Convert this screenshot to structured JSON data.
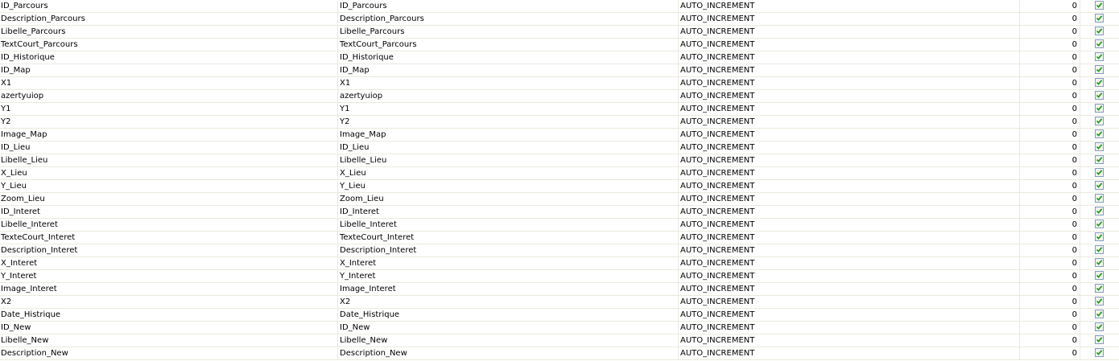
{
  "rows": [
    {
      "name": "ID_Parcours",
      "label": "ID_Parcours",
      "type": "AUTO_INCREMENT",
      "value": "0",
      "checked": true
    },
    {
      "name": "Description_Parcours",
      "label": "Description_Parcours",
      "type": "AUTO_INCREMENT",
      "value": "0",
      "checked": true
    },
    {
      "name": "Libelle_Parcours",
      "label": "Libelle_Parcours",
      "type": "AUTO_INCREMENT",
      "value": "0",
      "checked": true
    },
    {
      "name": "TextCourt_Parcours",
      "label": "TextCourt_Parcours",
      "type": "AUTO_INCREMENT",
      "value": "0",
      "checked": true
    },
    {
      "name": "ID_Historique",
      "label": "ID_Historique",
      "type": "AUTO_INCREMENT",
      "value": "0",
      "checked": true
    },
    {
      "name": "ID_Map",
      "label": "ID_Map",
      "type": "AUTO_INCREMENT",
      "value": "0",
      "checked": true
    },
    {
      "name": "X1",
      "label": "X1",
      "type": "AUTO_INCREMENT",
      "value": "0",
      "checked": true
    },
    {
      "name": "azertyuiop",
      "label": "azertyuiop",
      "type": "AUTO_INCREMENT",
      "value": "0",
      "checked": true
    },
    {
      "name": "Y1",
      "label": "Y1",
      "type": "AUTO_INCREMENT",
      "value": "0",
      "checked": true
    },
    {
      "name": "Y2",
      "label": "Y2",
      "type": "AUTO_INCREMENT",
      "value": "0",
      "checked": true
    },
    {
      "name": "Image_Map",
      "label": "Image_Map",
      "type": "AUTO_INCREMENT",
      "value": "0",
      "checked": true
    },
    {
      "name": "ID_Lieu",
      "label": "ID_Lieu",
      "type": "AUTO_INCREMENT",
      "value": "0",
      "checked": true
    },
    {
      "name": "Libelle_Lieu",
      "label": "Libelle_Lieu",
      "type": "AUTO_INCREMENT",
      "value": "0",
      "checked": true
    },
    {
      "name": "X_Lieu",
      "label": "X_Lieu",
      "type": "AUTO_INCREMENT",
      "value": "0",
      "checked": true
    },
    {
      "name": "Y_Lieu",
      "label": "Y_Lieu",
      "type": "AUTO_INCREMENT",
      "value": "0",
      "checked": true
    },
    {
      "name": "Zoom_Lieu",
      "label": "Zoom_Lieu",
      "type": "AUTO_INCREMENT",
      "value": "0",
      "checked": true
    },
    {
      "name": "ID_Interet",
      "label": "ID_Interet",
      "type": "AUTO_INCREMENT",
      "value": "0",
      "checked": true
    },
    {
      "name": "Libelle_Interet",
      "label": "Libelle_Interet",
      "type": "AUTO_INCREMENT",
      "value": "0",
      "checked": true
    },
    {
      "name": "TexteCourt_Interet",
      "label": "TexteCourt_Interet",
      "type": "AUTO_INCREMENT",
      "value": "0",
      "checked": true
    },
    {
      "name": "Description_Interet",
      "label": "Description_Interet",
      "type": "AUTO_INCREMENT",
      "value": "0",
      "checked": true
    },
    {
      "name": "X_Interet",
      "label": "X_Interet",
      "type": "AUTO_INCREMENT",
      "value": "0",
      "checked": true
    },
    {
      "name": "Y_Interet",
      "label": "Y_Interet",
      "type": "AUTO_INCREMENT",
      "value": "0",
      "checked": true
    },
    {
      "name": "Image_Interet",
      "label": "Image_Interet",
      "type": "AUTO_INCREMENT",
      "value": "0",
      "checked": true
    },
    {
      "name": "X2",
      "label": "X2",
      "type": "AUTO_INCREMENT",
      "value": "0",
      "checked": true
    },
    {
      "name": "Date_Histrique",
      "label": "Date_Histrique",
      "type": "AUTO_INCREMENT",
      "value": "0",
      "checked": true
    },
    {
      "name": "ID_New",
      "label": "ID_New",
      "type": "AUTO_INCREMENT",
      "value": "0",
      "checked": true
    },
    {
      "name": "Libelle_New",
      "label": "Libelle_New",
      "type": "AUTO_INCREMENT",
      "value": "0",
      "checked": true
    },
    {
      "name": "Description_New",
      "label": "Description_New",
      "type": "AUTO_INCREMENT",
      "value": "0",
      "checked": true
    }
  ],
  "colors": {
    "grid_line": "#ebe9dd",
    "checkbox_border": "#7b9cbd",
    "check_mark": "#21a121"
  },
  "icons": {
    "checkbox": "checkmark-icon"
  }
}
